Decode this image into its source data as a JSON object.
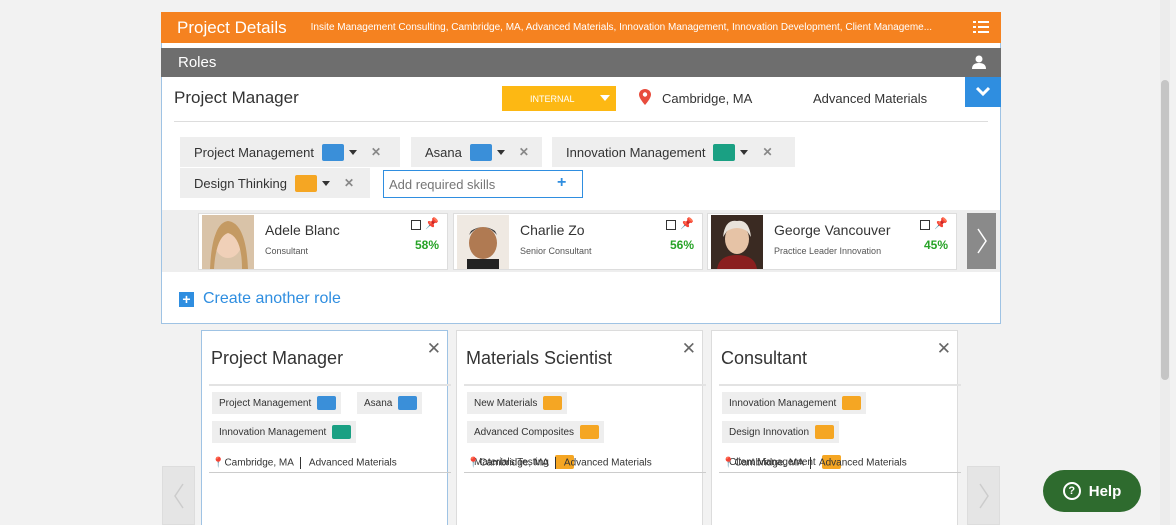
{
  "project_bar": {
    "title": "Project Details",
    "subtitle": "Insite Management Consulting, Cambridge, MA, Advanced Materials, Innovation Management, Innovation Development, Client Manageme...",
    "icon": "list-icon"
  },
  "roles_bar": {
    "title": "Roles",
    "icon": "user-icon"
  },
  "current_role": {
    "title": "Project Manager",
    "type": "INTERNAL",
    "location": "Cambridge, MA",
    "practice": "Advanced Materials",
    "skills": [
      {
        "label": "Project Management",
        "badge": "handshake-icon",
        "color": "#3a8fd9"
      },
      {
        "label": "Asana",
        "badge": "handshake-icon",
        "color": "#3a8fd9"
      },
      {
        "label": "Innovation Management",
        "badge": "pencil-icon",
        "color": "#1aa083"
      },
      {
        "label": "Design Thinking",
        "badge": "laurel-icon",
        "color": "#f5a623"
      }
    ],
    "skill_placeholder": "Add required skills"
  },
  "candidates": [
    {
      "name": "Adele Blanc",
      "role": "Consultant",
      "match": "58%"
    },
    {
      "name": "Charlie Zo",
      "role": "Senior Consultant",
      "match": "56%"
    },
    {
      "name": "George Vancouver",
      "role": "Practice Leader Innovation",
      "match": "45%"
    }
  ],
  "create_role_label": "Create another role",
  "role_cards": [
    {
      "title": "Project Manager",
      "skills": [
        {
          "label": "Project Management",
          "badge": "handshake-icon"
        },
        {
          "label": "Asana",
          "badge": "handshake-icon"
        },
        {
          "label": "Innovation Management",
          "badge": "pencil-icon"
        }
      ],
      "location": "Cambridge, MA",
      "practice": "Advanced Materials"
    },
    {
      "title": "Materials Scientist",
      "skills": [
        {
          "label": "New Materials",
          "badge": "laurel-icon"
        },
        {
          "label": "Advanced Composites",
          "badge": "laurel-icon"
        },
        {
          "label": "Materials Testing",
          "badge": "laurel-icon"
        }
      ],
      "location": "Cambridge, MA",
      "practice": "Advanced Materials"
    },
    {
      "title": "Consultant",
      "skills": [
        {
          "label": "Innovation Management",
          "badge": "laurel-icon"
        },
        {
          "label": "Design Innovation",
          "badge": "laurel-icon"
        },
        {
          "label": "Client Management",
          "badge": "laurel-icon"
        }
      ],
      "location": "Cambridge, MA",
      "practice": "Advanced Materials"
    }
  ],
  "help_label": "Help",
  "colors": {
    "accent_orange": "#f58220",
    "accent_blue": "#2f8ee0",
    "match_green": "#27a327",
    "help_green": "#2e6b2e"
  }
}
